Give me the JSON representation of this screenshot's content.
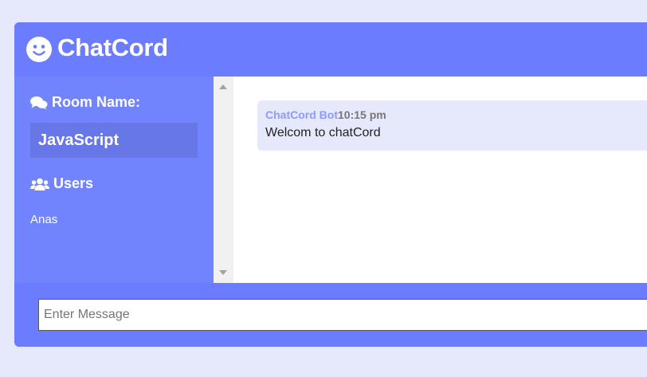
{
  "header": {
    "app_title": "ChatCord",
    "logo_icon": "smile-icon"
  },
  "sidebar": {
    "room_heading": "Room Name:",
    "room_icon": "comments-icon",
    "room_name": "JavaScript",
    "users_heading": "Users",
    "users_icon": "users-icon",
    "users": [
      "Anas"
    ]
  },
  "messages": [
    {
      "author": "ChatCord Bot",
      "time": "10:15 pm",
      "text": "Welcom to chatCord"
    }
  ],
  "form": {
    "placeholder": "Enter Message"
  },
  "colors": {
    "primary": "#6b7cfe",
    "sidebar": "#7283fe",
    "room_highlight": "#6877e8",
    "message_bg": "#e6e9fb",
    "page_bg": "#e6e9fb"
  }
}
